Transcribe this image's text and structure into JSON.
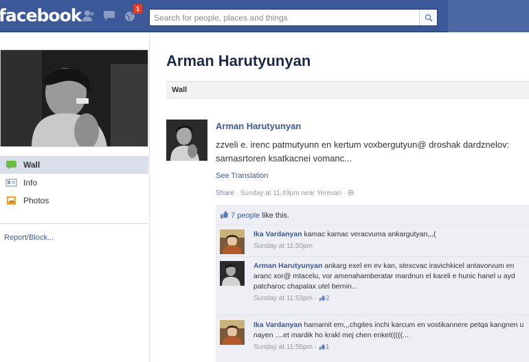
{
  "header": {
    "logo": "facebook",
    "notification_count": "1",
    "search_placeholder": "Search for people, places and things"
  },
  "profile": {
    "name": "Arman Harutyunyan"
  },
  "leftnav": {
    "items": [
      {
        "label": "Wall",
        "icon": "wall-icon",
        "selected": true
      },
      {
        "label": "Info",
        "icon": "info-icon",
        "selected": false
      },
      {
        "label": "Photos",
        "icon": "photos-icon",
        "selected": false
      }
    ],
    "report": "Report/Block..."
  },
  "wall_tab": "Wall",
  "post": {
    "author": "Arman Harutyunyan",
    "text": "zzveli e. irenc patmutyunn en kertum voxbergutyun@ droshak dardznelov: sarnasrtoren ksatkacnei vomanc...",
    "see_translation": "See Translation",
    "share": "Share",
    "timestamp": " · Sunday at 11:49pm near Yerevan · "
  },
  "likes": {
    "people": "7 people",
    "suffix": " like this."
  },
  "comments": [
    {
      "author": "Ika Vardanyan",
      "text": " kamac kamac veracvuma ankargutyan,,,(",
      "time": "Sunday at 11:50pm",
      "likes": ""
    },
    {
      "author": "Arman Harutyunyan",
      "text": " ankarg exel en ev kan, stexcvac iravichkicel antavorvum en aranc xor@ mtacelu, vor amenahamberatar mardnun el kareli e hunic hanel u ayd patcharoc chapalax utel bernin...",
      "time": "Sunday at 11:53pm",
      "likes": "2"
    },
    {
      "author": "Ika Vardanyan",
      "text": " hamamit em,,,chgites inchi karcum en vostikannere petqa kangnen u nayen ....et mardik ho krakl mej chen enkel(((((...",
      "time": "Sunday at 11:55pm",
      "likes": "1"
    }
  ],
  "colors": {
    "brand_blue": "#3b5998",
    "link_blue": "#3b5998",
    "ufi_bg": "#edeff4"
  }
}
